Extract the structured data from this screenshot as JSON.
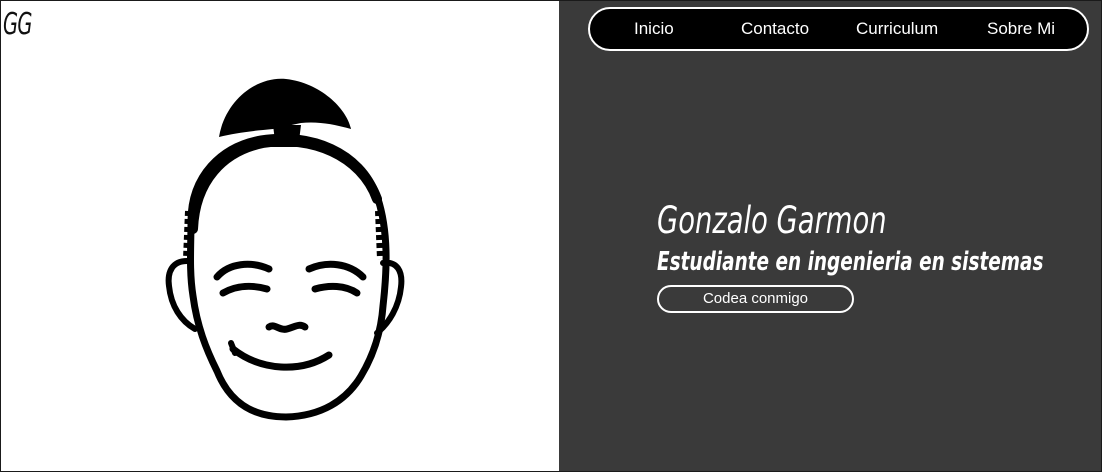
{
  "brand": {
    "logo_text": "GG"
  },
  "nav": {
    "items": [
      {
        "label": "Inicio"
      },
      {
        "label": "Contacto"
      },
      {
        "label": "Curriculum"
      },
      {
        "label": "Sobre Mi"
      }
    ]
  },
  "hero": {
    "name": "Gonzalo Garmon",
    "role": "Estudiante en ingenieria en sistemas",
    "cta_label": "Codea conmigo"
  },
  "colors": {
    "left_panel": "#ffffff",
    "right_panel": "#3a3a3a",
    "nav_bg": "#000000",
    "text_light": "#ffffff",
    "ink": "#000000"
  },
  "icons": {
    "portrait": "cartoon-face-illustration"
  }
}
